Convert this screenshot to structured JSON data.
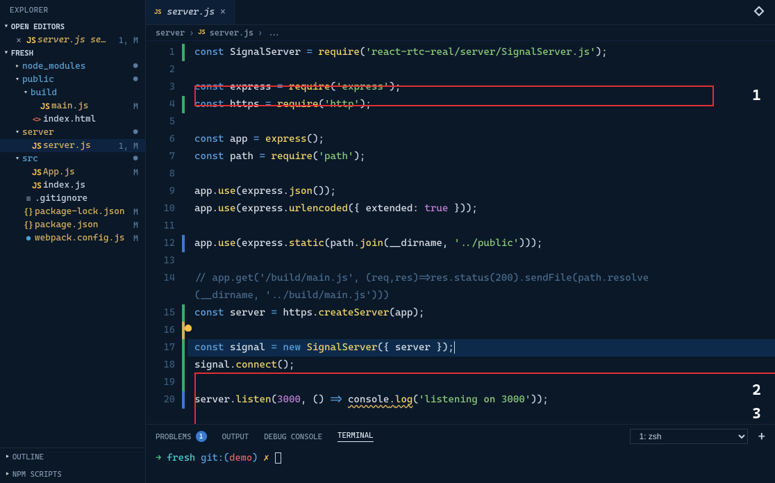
{
  "sidebar": {
    "title": "EXPLORER",
    "open_editors_label": "OPEN EDITORS",
    "open_editors": {
      "file": "server.js",
      "suffix": "se…",
      "status": "1, M"
    },
    "project": "FRESH",
    "tree": [
      {
        "type": "folder",
        "label": "node_modules",
        "depth": 1,
        "open": false,
        "dot": true
      },
      {
        "type": "folder",
        "label": "public",
        "depth": 1,
        "open": true,
        "dot": true,
        "mod": false
      },
      {
        "type": "folder",
        "label": "build",
        "depth": 2,
        "open": true
      },
      {
        "type": "file",
        "label": "main.js",
        "depth": 3,
        "icon": "js",
        "status": "M",
        "mod": true
      },
      {
        "type": "file",
        "label": "index.html",
        "depth": 2,
        "icon": "html"
      },
      {
        "type": "folder",
        "label": "server",
        "depth": 1,
        "open": true,
        "dot": true,
        "mod": true
      },
      {
        "type": "file",
        "label": "server.js",
        "depth": 2,
        "icon": "js",
        "status": "1, M",
        "mod": true,
        "selected": true
      },
      {
        "type": "folder",
        "label": "src",
        "depth": 1,
        "open": true,
        "dot": true
      },
      {
        "type": "file",
        "label": "App.js",
        "depth": 2,
        "icon": "js",
        "status": "M",
        "mod": true
      },
      {
        "type": "file",
        "label": "index.js",
        "depth": 2,
        "icon": "js"
      },
      {
        "type": "file",
        "label": ".gitignore",
        "depth": 1,
        "icon": "lines"
      },
      {
        "type": "file",
        "label": "package-lock.json",
        "depth": 1,
        "icon": "json",
        "status": "M",
        "mod": true
      },
      {
        "type": "file",
        "label": "package.json",
        "depth": 1,
        "icon": "json",
        "status": "M",
        "mod": true
      },
      {
        "type": "file",
        "label": "webpack.config.js",
        "depth": 1,
        "icon": "webpack",
        "status": "M",
        "mod": true
      }
    ],
    "outline": "OUTLINE",
    "npm": "NPM SCRIPTS"
  },
  "tab": {
    "filename": "server.js"
  },
  "breadcrumb": {
    "p1": "server",
    "p2": "server.js",
    "p3": "..."
  },
  "code": {
    "lines": [
      {
        "n": 1,
        "gut": "green",
        "html": "<span class='tok-kw'>const</span> <span class='tok-var'>SignalServer</span> <span class='tok-op'>=</span> <span class='tok-fn'>require</span><span class='tok-punc'>(</span><span class='tok-str'>'react-rtc-real/server/SignalServer.js'</span><span class='tok-punc'>);</span>"
      },
      {
        "n": 2,
        "html": ""
      },
      {
        "n": 3,
        "html": "<span class='tok-kw'>const</span> <span class='tok-var'>express</span> <span class='tok-op'>=</span> <span class='tok-fn'>require</span><span class='tok-punc'>(</span><span class='tok-str'>'express'</span><span class='tok-punc'>);</span>"
      },
      {
        "n": 4,
        "gut": "green",
        "html": "<span class='tok-kw'>const</span> <span class='tok-var'>https</span> <span class='tok-op'>=</span> <span class='tok-fn'>require</span><span class='tok-punc'>(</span><span class='tok-str'>'http'</span><span class='tok-punc'>);</span>"
      },
      {
        "n": 5,
        "html": ""
      },
      {
        "n": 6,
        "html": "<span class='tok-kw'>const</span> <span class='tok-var'>app</span> <span class='tok-op'>=</span> <span class='tok-fn'>express</span><span class='tok-punc'>();</span>"
      },
      {
        "n": 7,
        "html": "<span class='tok-kw'>const</span> <span class='tok-var'>path</span> <span class='tok-op'>=</span> <span class='tok-fn'>require</span><span class='tok-punc'>(</span><span class='tok-str'>'path'</span><span class='tok-punc'>);</span>"
      },
      {
        "n": 8,
        "html": ""
      },
      {
        "n": 9,
        "html": "<span class='tok-var'>app</span><span class='tok-punc'>.</span><span class='tok-fn'>use</span><span class='tok-punc'>(</span><span class='tok-var'>express</span><span class='tok-punc'>.</span><span class='tok-fn'>json</span><span class='tok-punc'>());</span>"
      },
      {
        "n": 10,
        "html": "<span class='tok-var'>app</span><span class='tok-punc'>.</span><span class='tok-fn'>use</span><span class='tok-punc'>(</span><span class='tok-var'>express</span><span class='tok-punc'>.</span><span class='tok-fn'>urlencoded</span><span class='tok-punc'>({ </span><span class='tok-prop'>extended</span><span class='tok-punc'>: </span><span class='tok-const'>true</span><span class='tok-punc'> }));</span>"
      },
      {
        "n": 11,
        "html": ""
      },
      {
        "n": 12,
        "gut": "blue",
        "html": "<span class='tok-var'>app</span><span class='tok-punc'>.</span><span class='tok-fn'>use</span><span class='tok-punc'>(</span><span class='tok-var'>express</span><span class='tok-punc'>.</span><span class='tok-fn'>static</span><span class='tok-punc'>(</span><span class='tok-var'>path</span><span class='tok-punc'>.</span><span class='tok-fn'>join</span><span class='tok-punc'>(</span><span class='tok-var'>__dirname</span><span class='tok-punc'>, </span><span class='tok-str'>'../public'</span><span class='tok-punc'>)));</span>"
      },
      {
        "n": 13,
        "html": ""
      },
      {
        "n": 14,
        "html": "<span class='tok-cmt'>// app.get('/build/main.js', (req,res)=>res.status(200).sendFile(path.resolve</span>",
        "wrap": "<span class='tok-cmt'>(__dirname, '../build/main.js')))</span>"
      },
      {
        "n": 15,
        "gut": "green",
        "html": "<span class='tok-kw'>const</span> <span class='tok-var'>server</span> <span class='tok-op'>=</span> <span class='tok-var'>https</span><span class='tok-punc'>.</span><span class='tok-fn'>createServer</span><span class='tok-punc'>(</span><span class='tok-var'>app</span><span class='tok-punc'>);</span>"
      },
      {
        "n": 16,
        "gut": "yellow",
        "bulb": true,
        "html": ""
      },
      {
        "n": 17,
        "gut": "green",
        "hl": true,
        "html": "<span class='tok-kw'>const</span> <span class='tok-var'>signal</span> <span class='tok-op'>=</span> <span class='tok-new'>new</span> <span class='tok-fn'>SignalServer</span><span class='tok-punc'>({ </span><span class='tok-var'>server</span><span class='tok-punc'> });</span><span class='cursor'></span>"
      },
      {
        "n": 18,
        "gut": "green",
        "html": "<span class='tok-var'>signal</span><span class='tok-punc'>.</span><span class='tok-fn'>connect</span><span class='tok-punc'>();</span>"
      },
      {
        "n": 19,
        "gut": "green",
        "html": ""
      },
      {
        "n": 20,
        "gut": "blue",
        "html": "<span class='tok-var'>server</span><span class='tok-punc'>.</span><span class='tok-fn'>listen</span><span class='tok-punc'>(</span><span class='tok-const'>3000</span><span class='tok-punc'>, () </span><span class='tok-op'>=></span><span class='tok-punc'> </span><span class='tok-var wavy'>console</span><span class='tok-punc wavy'>.</span><span class='tok-fn wavy'>log</span><span class='tok-punc'>(</span><span class='tok-str'>'listening on 3000'</span><span class='tok-punc'>));</span>"
      }
    ]
  },
  "annotations": {
    "a1": "1",
    "a2": "2",
    "a3": "3"
  },
  "panel": {
    "tabs": {
      "problems": "PROBLEMS",
      "problems_count": "1",
      "output": "OUTPUT",
      "debug": "DEBUG CONSOLE",
      "terminal": "TERMINAL"
    },
    "term_select": "1: zsh",
    "plus": "+"
  },
  "terminal": {
    "arrow": "→",
    "project": "fresh",
    "git_label": "git:(",
    "branch": "demo",
    "git_close": ")",
    "dirty": "✗"
  }
}
